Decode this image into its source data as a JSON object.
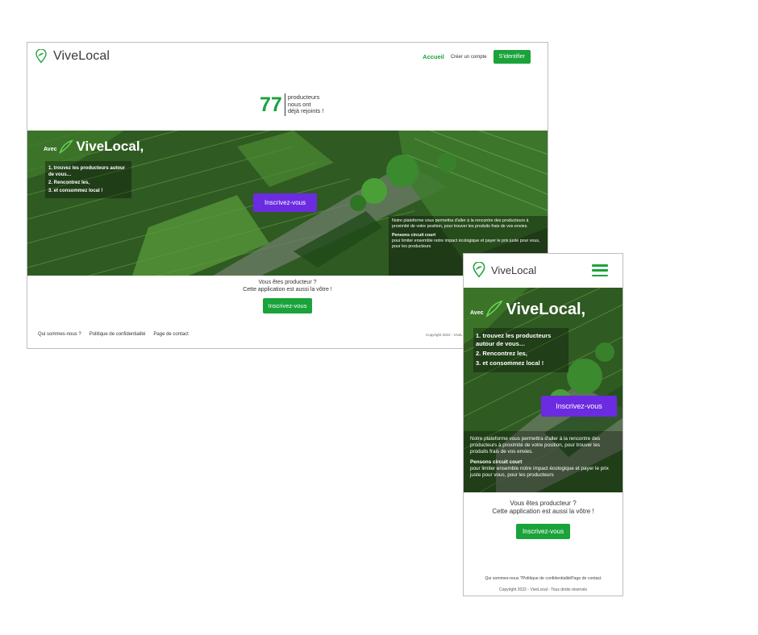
{
  "brand": {
    "name": "ViveLocal",
    "accent": "#1aa33a",
    "cta_color": "#6b2be0"
  },
  "desktop": {
    "nav": {
      "home": "Accueil",
      "signup": "Créer un compte",
      "login": "S'identifier"
    },
    "counter": {
      "number": "77",
      "line1": "producteurs",
      "line2": "nous ont",
      "line3": "déjà rejoints !"
    },
    "hero": {
      "avec": "Avec",
      "title": "ViveLocal,",
      "steps": [
        "1. trouvez les producteurs autour de vous…",
        "2. Rencontrez les,",
        "3. et consommez local !"
      ],
      "cta": "Inscrivez-vous",
      "info_text": "Notre plateforme vous permettra d'aller à la rencontre des producteurs à proximité de votre position, pour trouver les produits frais de vos envies.",
      "info_bold": "Pensons circuit court",
      "info_text2": "pour limiter ensemble notre impact écologique et payer le prix juste pour vous, pour les producteurs"
    },
    "producer": {
      "line1": "Vous êtes producteur ?",
      "line2": "Cette application est aussi la vôtre !",
      "button": "Inscrivez-vous"
    },
    "footer": {
      "links": [
        "Qui sommes-nous ?",
        "Politique de confidentialité",
        "Page de contact"
      ],
      "copyright": "Copyright 2022 - ViveLocal - Tous droits réservés"
    }
  },
  "mobile": {
    "hero": {
      "avec": "Avec",
      "title": "ViveLocal,",
      "steps": [
        "1. trouvez les producteurs autour de vous…",
        "2. Rencontrez les,",
        "3. et consommez local !"
      ],
      "cta": "Inscrivez-vous",
      "info_text": "Notre plateforme vous permettra d'aller à la rencontre des producteurs à proximité de votre position, pour trouver les produits frais de vos envies.",
      "info_bold": "Pensons circuit court",
      "info_text2": "pour limiter ensemble notre impact écologique et payer le prix juste pour vous, pour les producteurs"
    },
    "producer": {
      "line1": "Vous êtes producteur ?",
      "line2": "Cette application est aussi la vôtre !",
      "button": "Inscrivez-vous"
    },
    "footer": {
      "links": [
        "Qui sommes-nous ?",
        "Politique de confidentialité",
        "Page de contact"
      ],
      "copyright": "Copyright 2022 - ViveLocal - Tous droits réservés"
    }
  }
}
